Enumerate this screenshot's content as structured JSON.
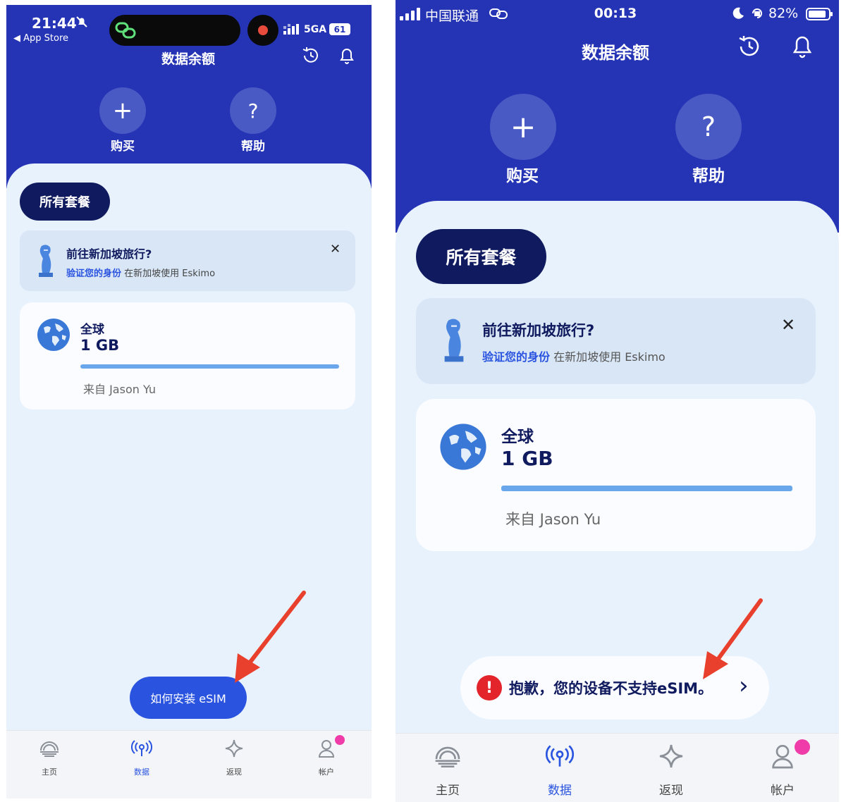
{
  "left": {
    "status": {
      "time": "21:44",
      "back_label": "◀ App Store",
      "network": "5GA",
      "battery": "61"
    },
    "header": {
      "title": "数据余额"
    },
    "actions": [
      {
        "label": "购买",
        "glyph": "+"
      },
      {
        "label": "帮助",
        "glyph": "?"
      }
    ],
    "filter": {
      "label": "所有套餐"
    },
    "promo": {
      "title": "前往新加坡旅行?",
      "link": "验证您的身份",
      "rest": " 在新加坡使用 Eskimo",
      "close": "✕"
    },
    "plan": {
      "region": "全球",
      "amount": "1 GB",
      "from": "来自 Jason Yu",
      "remaining_fraction": 1.0
    },
    "floating": {
      "label": "如何安装 eSIM"
    },
    "nav": [
      {
        "label": "主页",
        "icon": "home-icon"
      },
      {
        "label": "数据",
        "icon": "antenna-icon",
        "active": true
      },
      {
        "label": "返现",
        "icon": "sparkle-icon"
      },
      {
        "label": "帐户",
        "icon": "person-icon"
      }
    ]
  },
  "right": {
    "status": {
      "carrier": "中国联通",
      "time": "00:13",
      "battery": "82%"
    },
    "header": {
      "title": "数据余额"
    },
    "actions": [
      {
        "label": "购买",
        "glyph": "+"
      },
      {
        "label": "帮助",
        "glyph": "?"
      }
    ],
    "filter": {
      "label": "所有套餐"
    },
    "promo": {
      "title": "前往新加坡旅行?",
      "link": "验证您的身份",
      "rest": " 在新加坡使用 Eskimo",
      "close": "✕"
    },
    "plan": {
      "region": "全球",
      "amount": "1 GB",
      "from": "来自 Jason Yu",
      "remaining_fraction": 1.0
    },
    "toast": {
      "message": "抱歉，您的设备不支持eSIM。",
      "icon": "!",
      "chevron": "›"
    },
    "nav": [
      {
        "label": "主页",
        "icon": "home-icon"
      },
      {
        "label": "数据",
        "icon": "antenna-icon",
        "active": true
      },
      {
        "label": "返现",
        "icon": "sparkle-icon"
      },
      {
        "label": "帐户",
        "icon": "person-icon"
      }
    ]
  },
  "colors": {
    "hero_blue": "#2534b4",
    "dark_navy": "#101a5e",
    "accent_blue": "#2a54e0",
    "sheet_bg": "#e8f2fd",
    "error_red": "#e3242b",
    "badge_pink": "#f03ca8",
    "arrow_red": "#e8402c"
  }
}
